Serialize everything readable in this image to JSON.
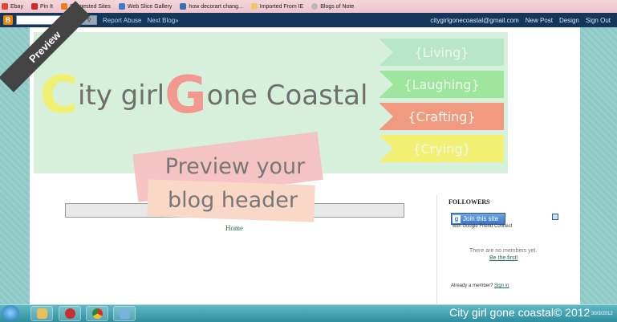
{
  "favorites": [
    {
      "label": "Ebay",
      "color": "#d94a3a"
    },
    {
      "label": "Pin It",
      "color": "#cc2b2b"
    },
    {
      "label": "Suggested Sites",
      "color": "#e87e22"
    },
    {
      "label": "Web Slice Gallery",
      "color": "#3e7cc9"
    },
    {
      "label": "how decorart chang...",
      "color": "#3a6fb3"
    },
    {
      "label": "Imported From IE",
      "color": "#e9c96a"
    },
    {
      "label": "Blogs of Note",
      "color": "#b9b9b9"
    }
  ],
  "navbar": {
    "report_abuse": "Report Abuse",
    "next_blog": "Next Blog»",
    "email": "citygirlgonecoastal@gmail.com",
    "new_post": "New Post",
    "design": "Design",
    "sign_out": "Sign Out"
  },
  "header": {
    "preview_ribbon": "Preview",
    "title_c": "C",
    "title_part1": "ity girl",
    "title_g": "G",
    "title_part2": "one Coastal",
    "flags": [
      "{Living}",
      "{Laughing}",
      "{Crafting}",
      "{Crying}"
    ],
    "tape_line1": "Preview your",
    "tape_line2": "blog header"
  },
  "page": {
    "home_link": "Home"
  },
  "sidebar": {
    "followers_title": "FOLLOWERS",
    "join_button": "Join this site",
    "gfc_text": "with Google Friend Connect",
    "no_members": "There are no members yet.",
    "be_first": "Be the first!",
    "already_member": "Already a member?",
    "sign_in": "Sign in"
  },
  "watermark": "City girl gone coastal© 2012",
  "clock": "30/3/2012",
  "taskbar_apps": [
    {
      "name": "file-explorer",
      "color": "#e7c05a"
    },
    {
      "name": "media-player",
      "color": "#c7312b"
    },
    {
      "name": "chrome",
      "color": "#e0b12a"
    },
    {
      "name": "paint",
      "color": "#7ab0de"
    }
  ]
}
